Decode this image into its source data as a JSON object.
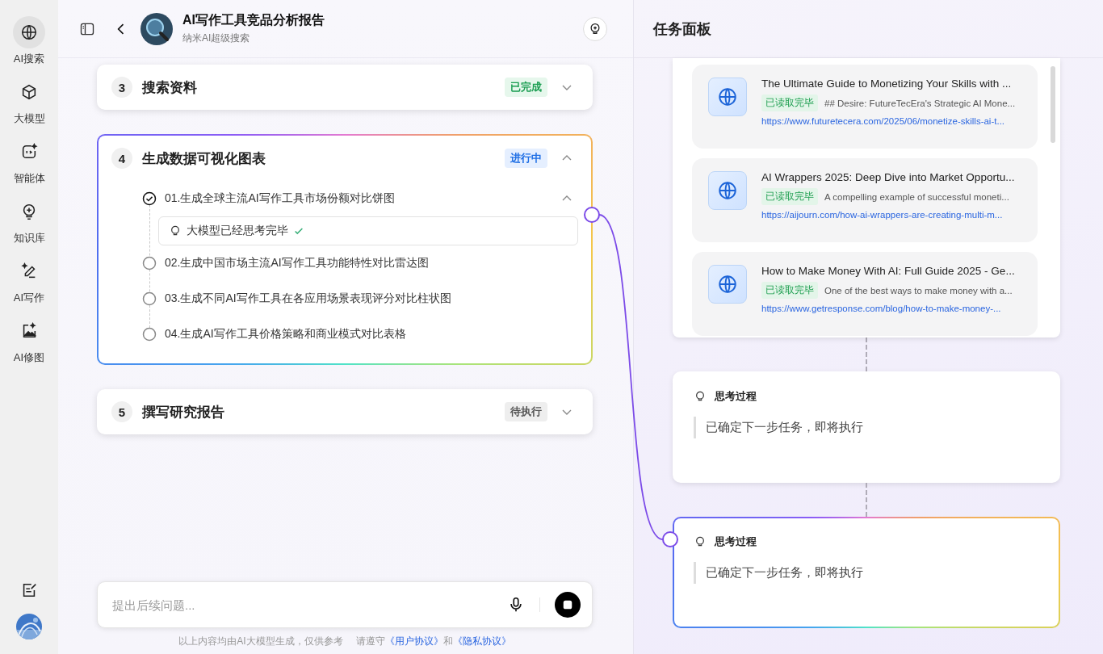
{
  "sidebar": {
    "items": [
      {
        "label": "AI搜索",
        "selected": true
      },
      {
        "label": "大模型",
        "selected": false
      },
      {
        "label": "智能体",
        "selected": false
      },
      {
        "label": "知识库",
        "selected": false
      },
      {
        "label": "AI写作",
        "selected": false
      },
      {
        "label": "AI修图",
        "selected": false
      }
    ]
  },
  "header": {
    "title": "AI写作工具竞品分析报告",
    "subtitle": "纳米AI超级搜索"
  },
  "steps": [
    {
      "number": "3",
      "title": "搜索资料",
      "kind": "done",
      "badge": "已完成",
      "expanded": false
    },
    {
      "number": "4",
      "title": "生成数据可视化图表",
      "kind": "running",
      "badge": "进行中",
      "expanded": true,
      "subtasks": [
        {
          "label": "01.生成全球主流AI写作工具市场份额对比饼图",
          "checked": true,
          "expanded": true,
          "thought": "大模型已经思考完毕"
        },
        {
          "label": "02.生成中国市场主流AI写作工具功能特性对比雷达图",
          "checked": false,
          "expanded": false
        },
        {
          "label": "03.生成不同AI写作工具在各应用场景表现评分对比柱状图",
          "checked": false,
          "expanded": false
        },
        {
          "label": "04.生成AI写作工具价格策略和商业模式对比表格",
          "checked": false,
          "expanded": false
        }
      ]
    },
    {
      "number": "5",
      "title": "撰写研究报告",
      "kind": "pending",
      "badge": "待执行",
      "expanded": false
    }
  ],
  "input": {
    "placeholder": "提出后续问题..."
  },
  "footer": {
    "note": "以上内容均由AI大模型生成，仅供参考",
    "agree": "请遵守",
    "link1": "《用户协议》",
    "and": "和",
    "link2": "《隐私协议》"
  },
  "task_panel": {
    "title": "任务面板",
    "sources": [
      {
        "title": "The Ultimate Guide to Monetizing Your Skills with ...",
        "badge": "已读取完毕",
        "snippet": "## Desire: FutureTecEra's Strategic AI Mone...",
        "url": "https://www.futuretecera.com/2025/06/monetize-skills-ai-t..."
      },
      {
        "title": "AI Wrappers 2025: Deep Dive into Market Opportu...",
        "badge": "已读取完毕",
        "snippet": "A compelling example of successful moneti...",
        "url": "https://aijourn.com/how-ai-wrappers-are-creating-multi-m..."
      },
      {
        "title": "How to Make Money With AI: Full Guide 2025 - Ge...",
        "badge": "已读取完毕",
        "snippet": "One of the best ways to make money with a...",
        "url": "https://www.getresponse.com/blog/how-to-make-money-..."
      }
    ],
    "thoughts": [
      {
        "heading": "思考过程",
        "text": "已确定下一步任务，即将执行",
        "active": false
      },
      {
        "heading": "思考过程",
        "text": "已确定下一步任务，即将执行",
        "active": true
      }
    ]
  }
}
